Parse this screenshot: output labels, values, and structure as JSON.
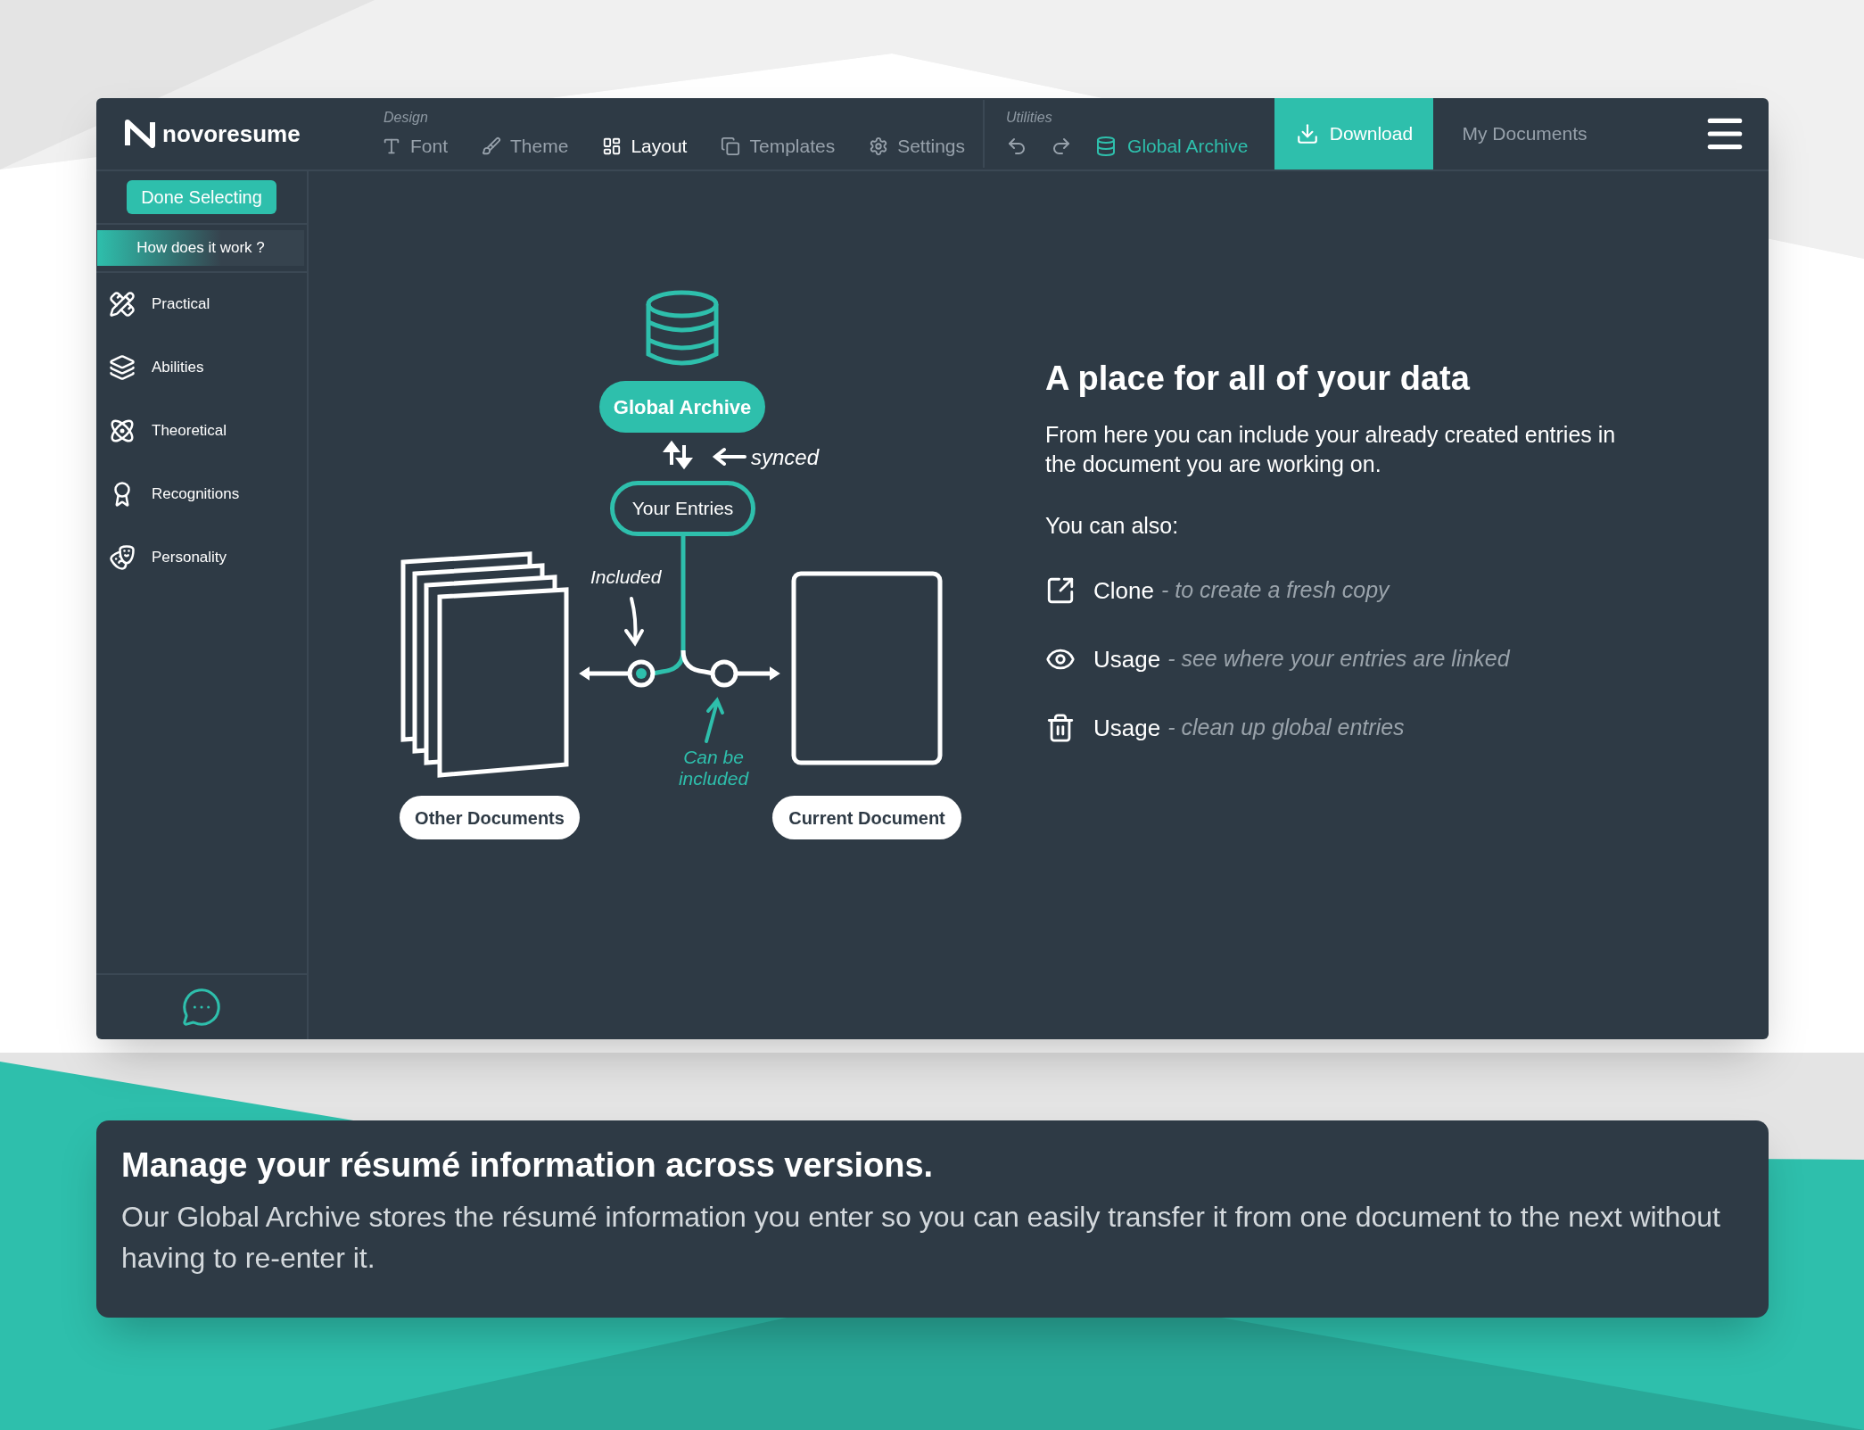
{
  "brand": {
    "name": "novoresume"
  },
  "toolbar": {
    "design_label": "Design",
    "design_items": [
      {
        "label": "Font",
        "selected": false
      },
      {
        "label": "Theme",
        "selected": false
      },
      {
        "label": "Layout",
        "selected": true
      },
      {
        "label": "Templates",
        "selected": false
      },
      {
        "label": "Settings",
        "selected": false
      }
    ],
    "utilities_label": "Utilities",
    "global_archive": {
      "label": "Global Archive",
      "selected": true
    },
    "download": "Download",
    "my_documents": "My Documents"
  },
  "sidebar": {
    "done_button": "Done Selecting",
    "help": "How does it work ?",
    "items": [
      {
        "label": "Practical"
      },
      {
        "label": "Abilities"
      },
      {
        "label": "Theoretical"
      },
      {
        "label": "Recognitions"
      },
      {
        "label": "Personality"
      }
    ]
  },
  "diagram": {
    "archive": "Global Archive",
    "synced": "synced",
    "entries": "Your Entries",
    "included": "Included",
    "can_be_included": "Can be included",
    "other": "Other Documents",
    "current": "Current Document"
  },
  "info": {
    "title": "A place for all of your data",
    "text": "From here you can include your already created entries in the document you are working on.",
    "also": "You can also:",
    "actions": [
      {
        "label": "Clone",
        "note": "- to create a fresh copy"
      },
      {
        "label": "Usage",
        "note": "- see where your entries are linked"
      },
      {
        "label": "Usage",
        "note": "- clean up global entries"
      }
    ]
  },
  "caption": {
    "title": "Manage your résumé information across versions.",
    "text": "Our Global Archive stores the résumé information you enter so you can easily transfer it from one document to the next without having to re-enter it."
  }
}
